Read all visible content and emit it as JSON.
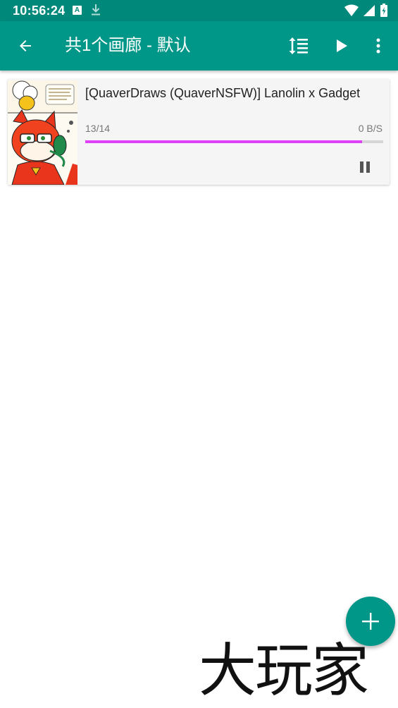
{
  "status_bar": {
    "time": "10:56:24",
    "icons": [
      "a-notification-icon",
      "download-icon",
      "wifi-icon",
      "signal-icon",
      "battery-icon"
    ]
  },
  "toolbar": {
    "title": "共1个画廊 - 默认",
    "icons": [
      "back-arrow-icon",
      "sort-icon",
      "play-icon",
      "more-vert-icon"
    ]
  },
  "download_item": {
    "title": "[QuaverDraws (QuaverNSFW)] Lanolin x Gadget",
    "count": "13/14",
    "speed": "0 B/S",
    "progress": 0.93,
    "progress_color": "#e040fb",
    "action_icon": "pause-icon"
  },
  "fab": {
    "icon": "plus-icon"
  },
  "watermark": {
    "text": "大玩家"
  },
  "colors": {
    "status_bar": "#00897b",
    "toolbar": "#009688",
    "accent": "#009688"
  }
}
